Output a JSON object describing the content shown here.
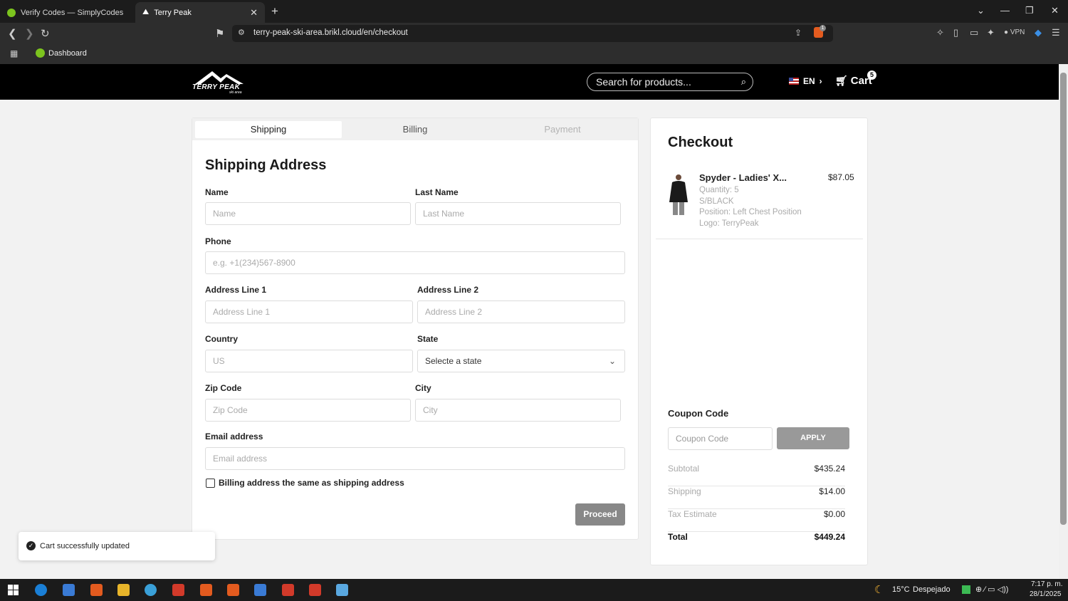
{
  "browser": {
    "tabs": [
      {
        "title": "Verify Codes — SimplyCodes",
        "active": false
      },
      {
        "title": "Terry Peak",
        "active": true
      }
    ],
    "url": "terry-peak-ski-area.brikl.cloud/en/checkout",
    "bookmarks": [
      {
        "label": "Dashboard"
      }
    ],
    "vpn_label": "VPN",
    "brave_badge": "1"
  },
  "site": {
    "logo_text": "TERRY PEAK",
    "logo_subtext": "ski area",
    "search_placeholder": "Search for products...",
    "language": "EN",
    "cart_label": "Cart",
    "cart_count": "5"
  },
  "steps": {
    "shipping": "Shipping",
    "billing": "Billing",
    "payment": "Payment"
  },
  "form": {
    "title": "Shipping Address",
    "name_label": "Name",
    "name_placeholder": "Name",
    "last_name_label": "Last Name",
    "last_name_placeholder": "Last Name",
    "phone_label": "Phone",
    "phone_placeholder": "e.g. +1(234)567-8900",
    "address1_label": "Address Line 1",
    "address1_placeholder": "Address Line 1",
    "address2_label": "Address Line 2",
    "address2_placeholder": "Address Line 2",
    "country_label": "Country",
    "country_value": "US",
    "state_label": "State",
    "state_value": "Selecte a state",
    "zip_label": "Zip Code",
    "zip_placeholder": "Zip Code",
    "city_label": "City",
    "city_placeholder": "City",
    "email_label": "Email address",
    "email_placeholder": "Email address",
    "same_billing_label": "Billing address the same as shipping address",
    "same_billing_checked": false,
    "proceed_label": "Proceed"
  },
  "checkout": {
    "title": "Checkout",
    "item": {
      "name": "Spyder - Ladies' X...",
      "price": "$87.05",
      "quantity": "Quantity: 5",
      "variant": "S/BLACK",
      "position": "Position: Left Chest Position",
      "logo": "Logo: TerryPeak"
    },
    "coupon_title": "Coupon Code",
    "coupon_placeholder": "Coupon Code",
    "apply_label": "APPLY",
    "subtotal_label": "Subtotal",
    "subtotal_value": "$435.24",
    "shipping_label": "Shipping",
    "shipping_value": "$14.00",
    "tax_label": "Tax Estimate",
    "tax_value": "$0.00",
    "total_label": "Total",
    "total_value": "$449.24"
  },
  "toast": {
    "message": "Cart successfully updated"
  },
  "taskbar": {
    "weather_temp": "15°C",
    "weather_desc": "Despejado",
    "time": "7:17 p. m.",
    "date": "28/1/2025"
  },
  "colors": {
    "header_bg": "#000000",
    "page_bg": "#f2f2f2",
    "button_disabled": "#888888",
    "muted_text": "#aaaaaa"
  }
}
